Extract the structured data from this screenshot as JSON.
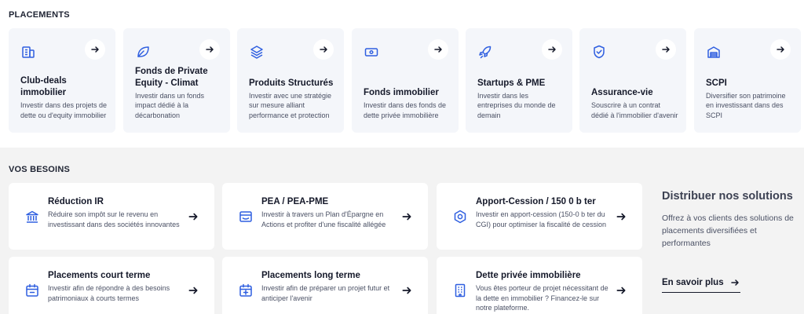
{
  "placements": {
    "title": "PLACEMENTS",
    "cards": [
      {
        "title": "Club-deals immobilier",
        "desc": "Investir dans des projets de dette ou d'equity immobilier",
        "icon": "building-icon"
      },
      {
        "title": "Fonds de Private Equity - Climat",
        "desc": "Investir dans un fonds impact dédié à la décarbonation",
        "icon": "leaf-icon"
      },
      {
        "title": "Produits Structurés",
        "desc": "Investir avec une stratégie sur mesure alliant performance et protection",
        "icon": "layers-icon"
      },
      {
        "title": "Fonds immobilier",
        "desc": "Investir dans des fonds de dette privée immobilière",
        "icon": "banknote-icon"
      },
      {
        "title": "Startups & PME",
        "desc": "Investir dans les entreprises du monde de demain",
        "icon": "rocket-icon"
      },
      {
        "title": "Assurance-vie",
        "desc": "Souscrire à un contrat dédié à l'immobilier d'avenir",
        "icon": "shield-check-icon"
      },
      {
        "title": "SCPI",
        "desc": "Diversifier son patrimoine en investissant dans des SCPI",
        "icon": "warehouse-icon"
      }
    ]
  },
  "besoins": {
    "title": "VOS BESOINS",
    "items": [
      {
        "title": "Réduction IR",
        "desc": "Réduire son impôt sur le revenu en investissant dans des sociétés innovantes",
        "icon": "bank-icon"
      },
      {
        "title": "PEA / PEA-PME",
        "desc": "Investir à travers un Plan d'Épargne en Actions et profiter d'une fiscalité allégée",
        "icon": "wallet-icon"
      },
      {
        "title": "Apport-Cession / 150 0 b ter",
        "desc": "Investir en apport-cession (150-0 b ter du CGI) pour optimiser la fiscalité de cession",
        "icon": "hexagon-icon"
      },
      {
        "title": "Placements court terme",
        "desc": "Investir afin de répondre à des besoins patrimoniaux à courts termes",
        "icon": "calendar-minus-icon"
      },
      {
        "title": "Placements long terme",
        "desc": "Investir afin de préparer un projet futur et anticiper l'avenir",
        "icon": "calendar-plus-icon"
      },
      {
        "title": "Dette privée immobilière",
        "desc": "Vous êtes porteur de projet nécessitant de la dette en immobilier ? Financez-le sur notre plateforme.",
        "icon": "office-building-icon"
      }
    ],
    "promo": {
      "title": "Distribuer nos solutions",
      "text": "Offrez à vos clients des solutions de placements diversifiées et performantes",
      "link": "En savoir plus"
    }
  },
  "colors": {
    "accent": "#2f5fe0",
    "card_bg": "#f4f6fa",
    "section_bg": "#f3f3f3"
  }
}
